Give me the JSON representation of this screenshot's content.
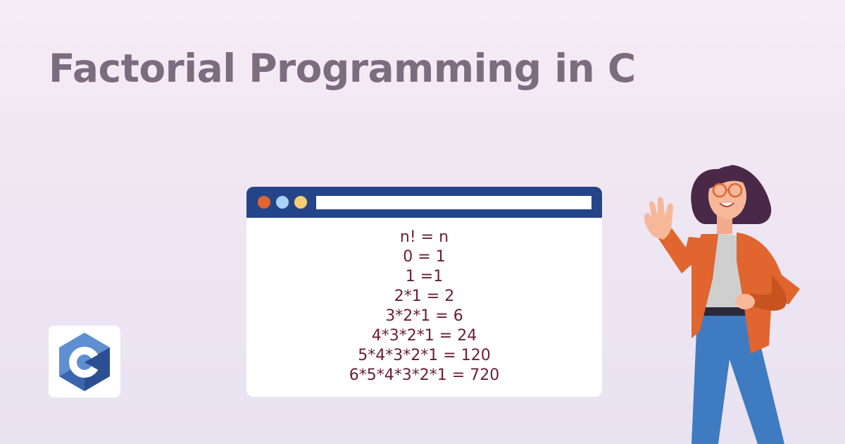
{
  "title": "Factorial Programming in C",
  "colors": {
    "title": "#7b6d7f",
    "browser_bar": "#25458a",
    "dot_red": "#e0652f",
    "dot_blue": "#a9d3f5",
    "dot_yellow": "#f6cd74",
    "code_text": "#6b1d35",
    "c_logo_dark": "#2b4f93",
    "c_logo_light": "#5d8fd1"
  },
  "browser": {
    "lines": [
      "n! = n",
      "0 = 1",
      "1 =1",
      "2*1 = 2",
      "3*2*1 = 6",
      "4*3*2*1 = 24",
      "5*4*3*2*1 = 120",
      "6*5*4*3*2*1 = 720"
    ]
  },
  "logo": {
    "letter": "C",
    "icon": "c-language-logo"
  },
  "illustration": {
    "icon": "waving-woman-illustration"
  }
}
